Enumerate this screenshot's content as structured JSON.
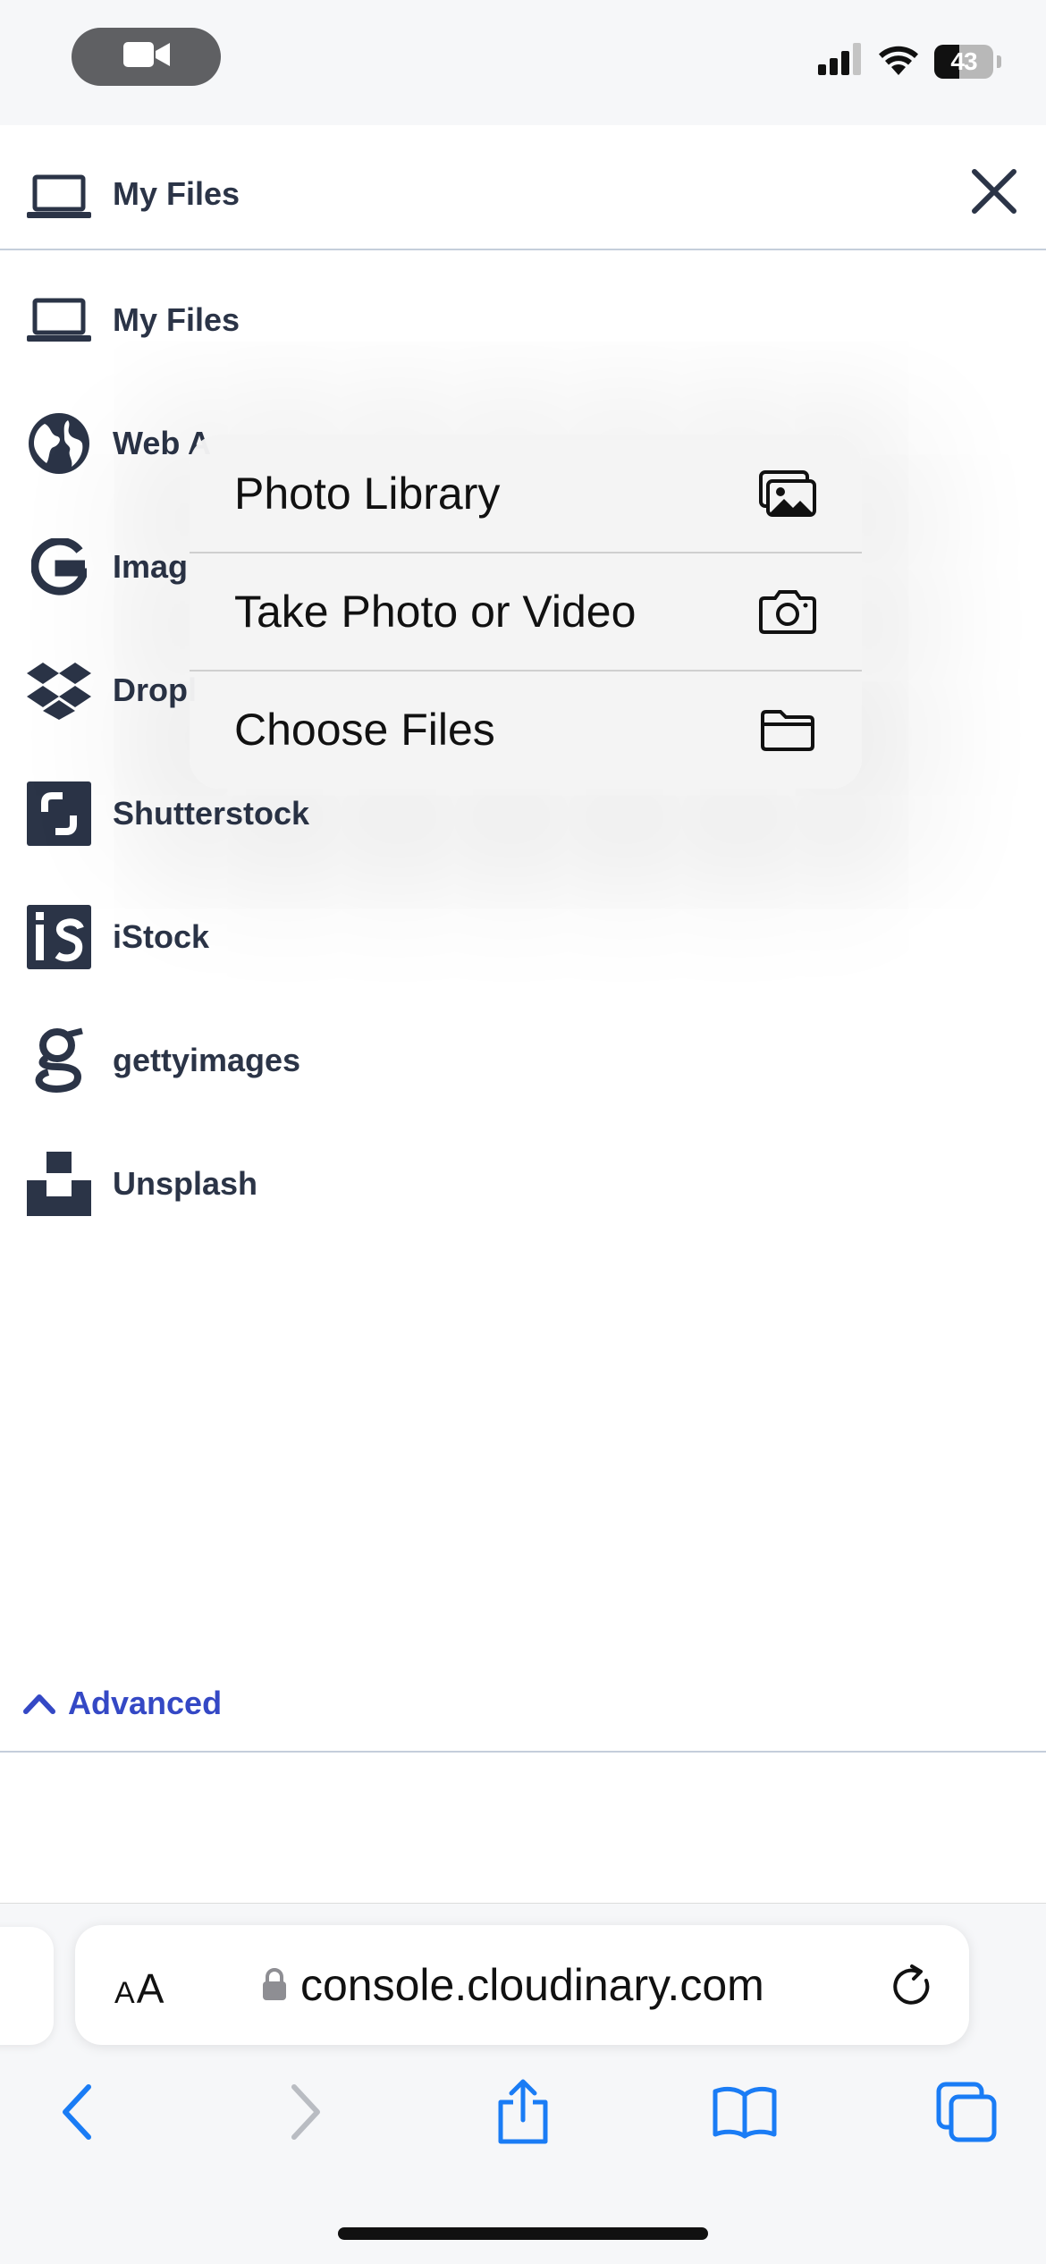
{
  "status_bar": {
    "battery_level": "43",
    "icons": [
      "video-camera-icon",
      "cellular-signal-icon",
      "wifi-icon",
      "battery-icon"
    ]
  },
  "header": {
    "title": "My Files",
    "icon": "laptop-icon",
    "close_icon": "close-icon"
  },
  "sources": [
    {
      "label": "My Files",
      "icon": "laptop-icon"
    },
    {
      "label": "Web A",
      "icon": "globe-icon"
    },
    {
      "label": "Imag",
      "icon": "google-icon"
    },
    {
      "label": "Dropl",
      "icon": "dropbox-icon"
    },
    {
      "label": "Shutterstock",
      "icon": "shutterstock-icon"
    },
    {
      "label": "iStock",
      "icon": "istock-icon"
    },
    {
      "label": "gettyimages",
      "icon": "gettyimages-icon"
    },
    {
      "label": "Unsplash",
      "icon": "unsplash-icon"
    }
  ],
  "advanced": {
    "label": "Advanced",
    "icon": "chevron-up-icon"
  },
  "popup_menu": {
    "items": [
      {
        "label": "Photo Library",
        "icon": "photo-library-icon"
      },
      {
        "label": "Take Photo or Video",
        "icon": "camera-icon"
      },
      {
        "label": "Choose Files",
        "icon": "folder-icon"
      }
    ]
  },
  "safari": {
    "aa_label_small": "A",
    "aa_label_large": "A",
    "url": "console.cloudinary.com",
    "nav_icons": [
      "back-icon",
      "forward-icon",
      "share-icon",
      "bookmarks-icon",
      "tabs-icon"
    ]
  },
  "colors": {
    "text_dark": "#2b3447",
    "accent_blue": "#3448c5",
    "safari_blue": "#1a7cf5",
    "divider": "#c5cedb"
  }
}
